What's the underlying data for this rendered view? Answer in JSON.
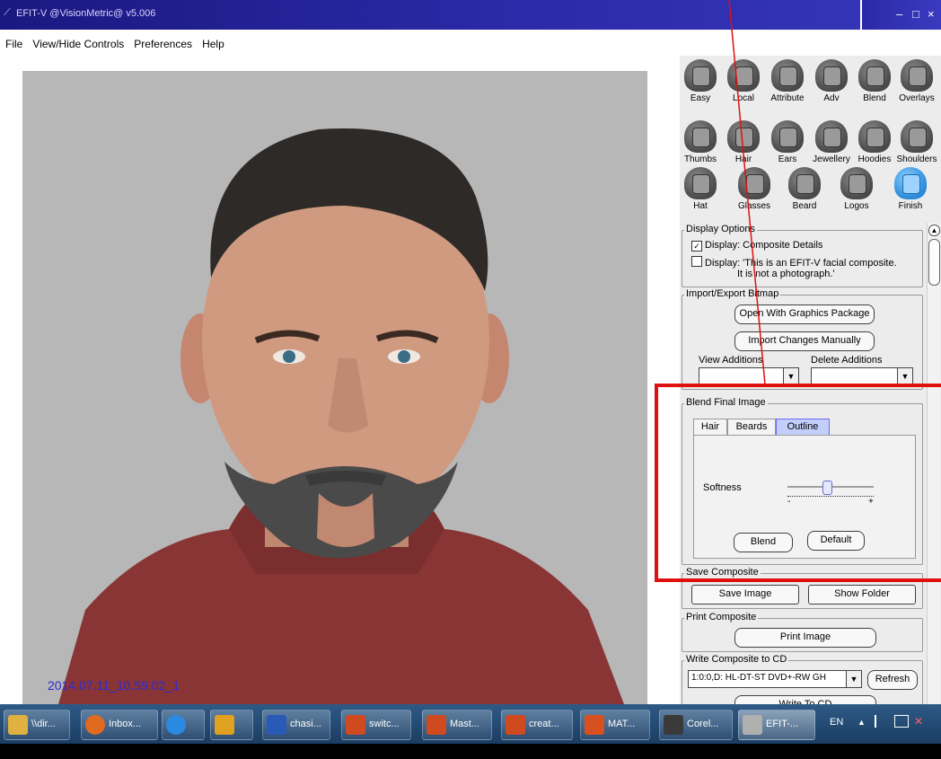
{
  "window": {
    "title": "EFIT-V @VisionMetric@  v5.006",
    "min_glyph": "–",
    "max_glyph": "□",
    "close_glyph": "×"
  },
  "menu": [
    "File",
    "View/Hide Controls",
    "Preferences",
    "Help"
  ],
  "composite": {
    "timestamp": "2014.07.11_10.59.02_1"
  },
  "tools": [
    "Easy",
    "Local",
    "Attribute",
    "Adv",
    "Blend",
    "Overlays",
    "Thumbs",
    "Hair",
    "Ears",
    "Jewellery",
    "Hoodies",
    "Shoulders",
    "Hat",
    "Glasses",
    "Beard",
    "Logos",
    "Finish"
  ],
  "display_options": {
    "title": "Display Options",
    "opt1": "Display: Composite Details",
    "opt1_checked": true,
    "opt2_line1": "Display: 'This is an EFIT-V facial composite.",
    "opt2_line2": "It is not a photograph.'",
    "opt2_checked": false
  },
  "import_export": {
    "title": "Import/Export Bitmap",
    "open_btn": "Open With Graphics Package",
    "import_btn": "Import Changes Manually",
    "view_label": "View Additions",
    "delete_label": "Delete Additions"
  },
  "blend_final": {
    "title": "Blend Final Image",
    "tabs": [
      "Hair",
      "Beards",
      "Outline"
    ],
    "active_tab": "Outline",
    "softness_label": "Softness",
    "minus": "-",
    "plus": "+",
    "softness_value": 0.45,
    "blend_btn": "Blend",
    "default_btn": "Default"
  },
  "save_composite": {
    "title": "Save Composite",
    "save_btn": "Save Image",
    "show_btn": "Show Folder"
  },
  "print_composite": {
    "title": "Print Composite",
    "print_btn": "Print Image"
  },
  "write_cd": {
    "title": "Write Composite to CD",
    "drive": "1:0:0,D: HL-DT-ST DVD+-RW GH",
    "refresh_btn": "Refresh",
    "write_btn": "Write To CD"
  },
  "taskbar": {
    "items": [
      "\\\\dir...",
      "Inbox...",
      "",
      "",
      "chasi...",
      "switc...",
      "Mast...",
      "creat...",
      "MAT...",
      "Corel...",
      "EFIT-..."
    ],
    "lang": "EN",
    "tray_up": "▲"
  }
}
